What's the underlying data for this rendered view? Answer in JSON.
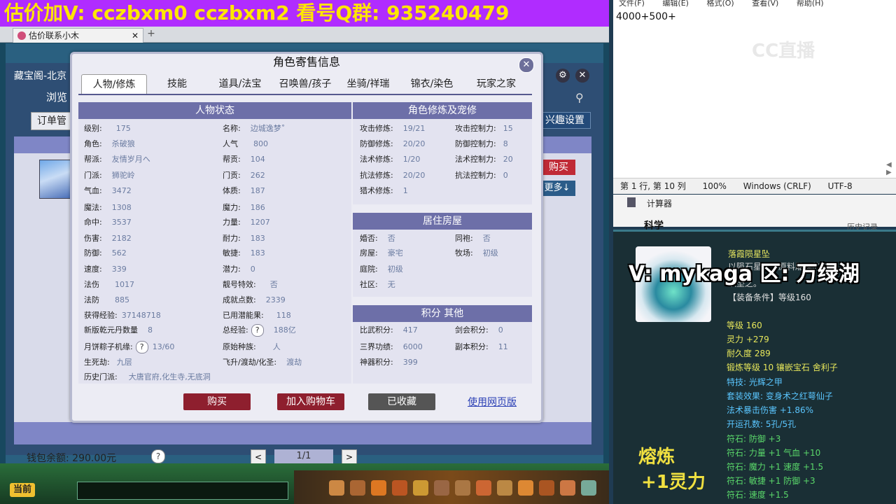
{
  "banner": {
    "text": "估价加V:   cczbxm0   cczbxm2   看号Q群: 935240479"
  },
  "browser_tab": {
    "title": "估价联系小木",
    "close": "✕",
    "new_tab": "+"
  },
  "background_page": {
    "site_title": "藏宝阁-北京",
    "browse": "浏览",
    "order_mgmt": "订单管",
    "interest_settings": "兴趣设置",
    "buy_side": "购买",
    "more_side": "更多↓",
    "wallet": "钱包余额: 290.00元",
    "wallet_help": "?",
    "pager": "1/1",
    "pager_prev": "<",
    "pager_next": ">"
  },
  "modal": {
    "title": "角色寄售信息",
    "close": "✕",
    "tabs": [
      "人物/修炼",
      "技能",
      "道具/法宝",
      "召唤兽/孩子",
      "坐骑/祥瑞",
      "锦衣/染色",
      "玩家之家"
    ],
    "status_title": "人物状态",
    "status_left": [
      {
        "label": "级别:",
        "value": "175"
      },
      {
        "label": "角色:",
        "value": "杀破狼"
      },
      {
        "label": "帮派:",
        "value": "友情岁月へ"
      },
      {
        "label": "门派:",
        "value": "狮驼岭"
      },
      {
        "label": "气血:",
        "value": "3472"
      },
      {
        "label": "魔法:",
        "value": "1308"
      },
      {
        "label": "命中:",
        "value": "3537"
      },
      {
        "label": "伤害:",
        "value": "2182"
      },
      {
        "label": "防御:",
        "value": "562"
      },
      {
        "label": "速度:",
        "value": "339"
      },
      {
        "label": "法伤",
        "value": "1017"
      },
      {
        "label": "法防",
        "value": "885"
      },
      {
        "label": "获得经验:",
        "value": "37148718"
      },
      {
        "label": "新版乾元丹数量",
        "value": "8"
      },
      {
        "label": "月饼粽子机缘:",
        "value": "13/60"
      },
      {
        "label": "生死劫:",
        "value": "九层"
      }
    ],
    "status_right": [
      {
        "label": "名称:",
        "value": "边城逸梦˚"
      },
      {
        "label": "人气",
        "value": "800"
      },
      {
        "label": "帮贡:",
        "value": "104"
      },
      {
        "label": "门贡:",
        "value": "262"
      },
      {
        "label": "体质:",
        "value": "187"
      },
      {
        "label": "魔力:",
        "value": "186"
      },
      {
        "label": "力量:",
        "value": "1207"
      },
      {
        "label": "耐力:",
        "value": "183"
      },
      {
        "label": "敏捷:",
        "value": "183"
      },
      {
        "label": "潜力:",
        "value": "0"
      },
      {
        "label": "靓号特效:",
        "value": "否"
      },
      {
        "label": "成就点数:",
        "value": "2339"
      },
      {
        "label": "已用潜能果:",
        "value": "118"
      },
      {
        "label": "总经验:",
        "value": "188亿"
      },
      {
        "label": "原始种族:",
        "value": "人"
      },
      {
        "label": "飞升/渡劫/化圣:",
        "value": "渡劫"
      }
    ],
    "history_label": "历史门派:",
    "history_value": "大唐官府,化生寺,无底洞",
    "cultivation_title": "角色修炼及宠修",
    "cultivation_left": [
      {
        "label": "攻击修炼:",
        "value": "19/21"
      },
      {
        "label": "防御修炼:",
        "value": "20/20"
      },
      {
        "label": "法术修炼:",
        "value": "1/20"
      },
      {
        "label": "抗法修炼:",
        "value": "20/20"
      },
      {
        "label": "猎术修炼:",
        "value": "1"
      }
    ],
    "cultivation_right": [
      {
        "label": "攻击控制力:",
        "value": "15"
      },
      {
        "label": "防御控制力:",
        "value": "8"
      },
      {
        "label": "法术控制力:",
        "value": "20"
      },
      {
        "label": "抗法控制力:",
        "value": "0"
      }
    ],
    "house_title": "居住房屋",
    "house_left": [
      {
        "label": "婚否:",
        "value": "否"
      },
      {
        "label": "房屋:",
        "value": "豪宅"
      },
      {
        "label": "庭院:",
        "value": "初级"
      },
      {
        "label": "社区:",
        "value": "无"
      }
    ],
    "house_right": [
      {
        "label": "同袍:",
        "value": "否"
      },
      {
        "label": "牧场:",
        "value": "初级"
      }
    ],
    "score_title": "积分 其他",
    "score_left": [
      {
        "label": "比武积分:",
        "value": "417"
      },
      {
        "label": "三界功绩:",
        "value": "6000"
      },
      {
        "label": "神器积分:",
        "value": "399"
      }
    ],
    "score_right": [
      {
        "label": "剑会积分:",
        "value": "0"
      },
      {
        "label": "副本积分:",
        "value": "11"
      }
    ],
    "buttons": {
      "buy": "购买",
      "cart": "加入购物车",
      "fav": "已收藏",
      "web": "使用网页版"
    }
  },
  "notepad": {
    "menu": [
      "文件(F)",
      "编辑(E)",
      "格式(O)",
      "查看(V)",
      "帮助(H)"
    ],
    "text": "4000+500+",
    "status": [
      "第 1 行, 第 10 列",
      "100%",
      "Windows (CRLF)",
      "UTF-8"
    ],
    "watermark": "CC直播"
  },
  "calculator": {
    "title": "计算器",
    "mode": "科学",
    "history": "历史记录"
  },
  "game": {
    "chat_button": "当前"
  },
  "tooltip": {
    "overlay": "V: mykaga  区: 万绿湖",
    "name": "落霞陨星坠",
    "desc": "以陨石星辰为原料雕琢的宝玉,",
    "desc2": "以坠之。",
    "req": "【装备条件】等级160",
    "lines_yellow": [
      "等级 160",
      "灵力 +279",
      "耐久度 289",
      "锻炼等级 10 镶嵌宝石 舍利子"
    ],
    "lines_cyan": [
      "特技: 光辉之甲",
      "套装效果: 变身术之红萼仙子",
      "法术暴击伤害 +1.86%",
      "开运孔数: 5孔/5孔"
    ],
    "lines_green": [
      "符石: 防御 +3",
      "符石: 力量 +1 气血 +10",
      "符石: 魔力 +1 速度 +1.5",
      "符石: 敏捷 +1 防御 +3",
      "符石: 速度 +1.5"
    ],
    "ronglian": "熔炼",
    "ronglian_value": "+1灵力"
  }
}
